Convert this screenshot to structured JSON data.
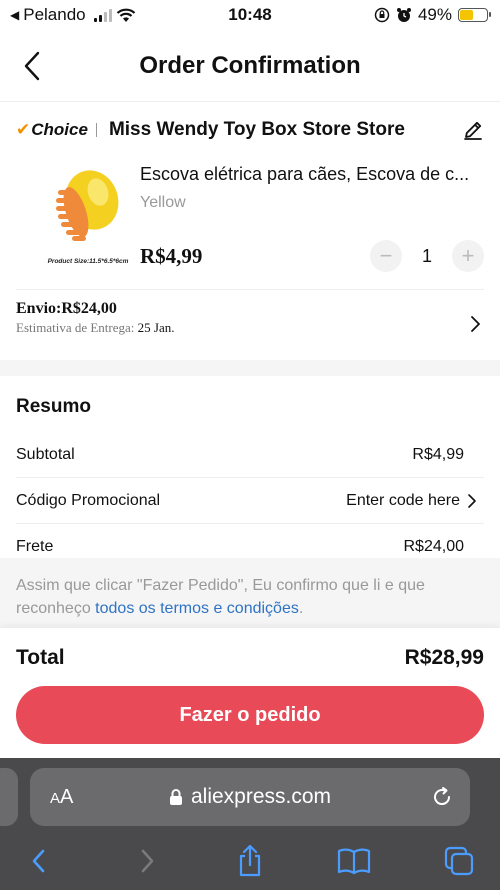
{
  "status": {
    "carrier": "Pelando",
    "time": "10:48",
    "battery": "49%",
    "battery_level": 0.49
  },
  "header": {
    "title": "Order Confirmation",
    "back_icon": "chevron-left-icon"
  },
  "store": {
    "badge_check": "✔",
    "badge_text": "Choice",
    "name": "Miss Wendy Toy Box Store Store",
    "edit_icon": "pencil-icon"
  },
  "product": {
    "title": "Escova elétrica para cães, Escova de c...",
    "variant": "Yellow",
    "price": "R$4,99",
    "quantity": "1",
    "image_caption": "Product Size:11.5*6.5*6cm"
  },
  "shipping": {
    "label": "Envio:R$24,00",
    "estimate_label": "Estimativa de Entrega:",
    "estimate_date": "25 Jan."
  },
  "summary": {
    "heading": "Resumo",
    "rows": [
      {
        "label": "Subtotal",
        "value": "R$4,99"
      },
      {
        "label": "Código Promocional",
        "value": "Enter code here"
      },
      {
        "label": "Frete",
        "value": "R$24,00"
      }
    ]
  },
  "terms": {
    "text": "Assim que clicar \"Fazer Pedido\", Eu confirmo que li e que reconheço ",
    "link": "todos os termos e condições",
    "end": "."
  },
  "order": {
    "total_label": "Total",
    "total_value": "R$28,99",
    "button_label": "Fazer o pedido"
  },
  "browser": {
    "aa_label_small": "A",
    "aa_label_big": "A",
    "url": "aliexpress.com"
  },
  "colors": {
    "accent": "#e94a57",
    "choice_check": "#f39200",
    "link": "#2e73c4"
  }
}
